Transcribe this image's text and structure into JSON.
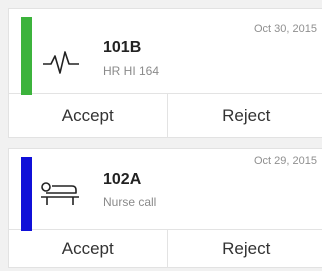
{
  "alerts": [
    {
      "room": "101B",
      "detail": "HR HI 164",
      "date": "Oct 30, 2015",
      "accent_color": "#3cb33c",
      "icon": "heartbeat-icon",
      "accept_label": "Accept",
      "reject_label": "Reject"
    },
    {
      "room": "102A",
      "detail": "Nurse call",
      "date": "Oct 29, 2015",
      "accent_color": "#1010d8",
      "icon": "patient-bed-icon",
      "accept_label": "Accept",
      "reject_label": "Reject"
    }
  ]
}
